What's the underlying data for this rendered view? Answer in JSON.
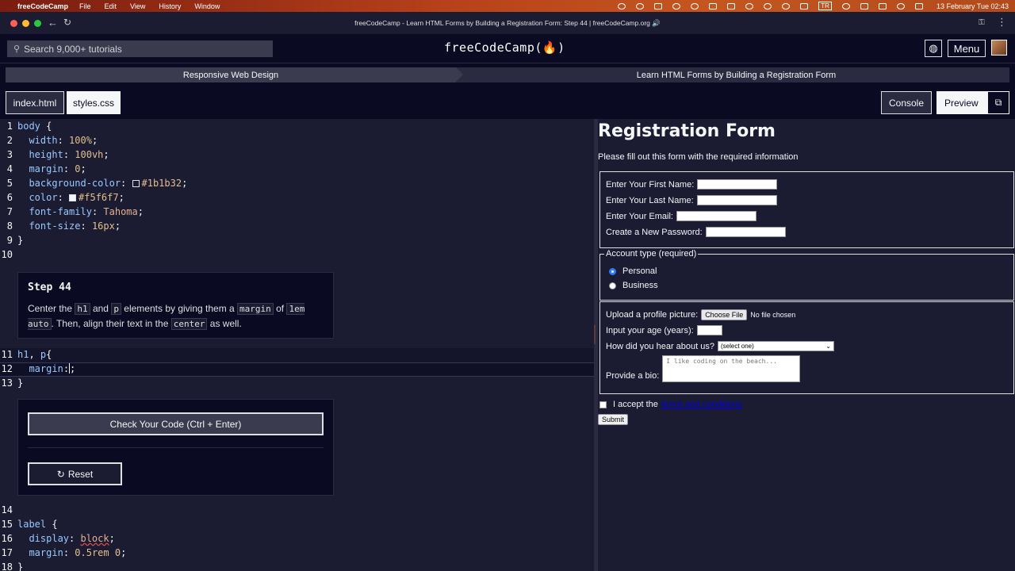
{
  "menubar": {
    "app_name": "freeCodeCamp",
    "menus": [
      "File",
      "Edit",
      "View",
      "History",
      "Window"
    ],
    "input_source": "TR",
    "clock": "13 February Tue  02:43"
  },
  "browser": {
    "window_title": "freeCodeCamp - Learn HTML Forms by Building a Registration Form: Step 44 | freeCodeCamp.org 🔊"
  },
  "header": {
    "search_placeholder": "Search 9,000+ tutorials",
    "logo": "freeCodeCamp(🔥)",
    "menu_label": "Menu"
  },
  "breadcrumbs": {
    "superblock": "Responsive Web Design",
    "block": "Learn HTML Forms by Building a Registration Form"
  },
  "tabs": {
    "index": "index.html",
    "styles": "styles.css",
    "console": "Console",
    "preview": "Preview"
  },
  "editor": {
    "line_numbers": [
      "1",
      "2",
      "3",
      "4",
      "5",
      "6",
      "7",
      "8",
      "9",
      "10",
      "11",
      "12",
      "13",
      "14",
      "15",
      "16",
      "17",
      "18"
    ],
    "step_title": "Step 44",
    "check_button": "Check Your Code (Ctrl + Enter)",
    "reset_button": "Reset"
  },
  "preview": {
    "title": "Registration Form",
    "subtitle": "Please fill out this form with the required information",
    "first_name_label": "Enter Your First Name:",
    "last_name_label": "Enter Your Last Name:",
    "email_label": "Enter Your Email:",
    "password_label": "Create a New Password:",
    "legend": "Account type (required)",
    "radio_personal": "Personal",
    "radio_business": "Business",
    "upload_label": "Upload a profile picture:",
    "choose_file": "Choose File",
    "no_file": "No file chosen",
    "age_label": "Input your age (years):",
    "referrer_label": "How did you hear about us?",
    "referrer_selected": "(select one)",
    "bio_label": "Provide a bio:",
    "bio_placeholder": "I like coding on the beach...",
    "accept_text": "I accept the",
    "terms_link": "terms and conditions",
    "submit": "Submit"
  },
  "colors": {
    "background": "#0a0a23",
    "editor_bg": "#1b1b32",
    "panel_gray": "#3b3b4f",
    "text": "#f5f6f7",
    "code_blue": "#99c9ff",
    "code_num": "#e2c08d"
  }
}
